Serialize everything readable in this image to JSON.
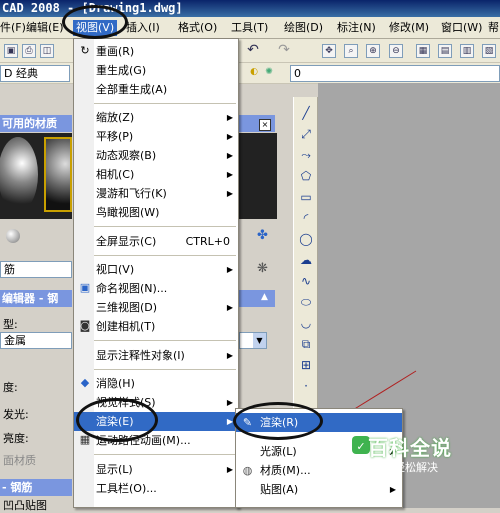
{
  "title": "CAD 2008 - [Drawing1.dwg]",
  "menubar": {
    "items": [
      "件(F)",
      "编辑(E)",
      "视图(V)",
      "插入(I)",
      "格式(O)",
      "工具(T)",
      "绘图(D)",
      "标注(N)",
      "修改(M)",
      "窗口(W)",
      "帮"
    ]
  },
  "toolbar": {
    "workspace_label": "D 经典",
    "layer_value": "0"
  },
  "palette": {
    "title1": "可用的材质",
    "combo_value": "筋",
    "title2": "编辑器 - 钢",
    "type_label": "型:",
    "template_value": "金属",
    "labels": [
      "度:",
      "发光:",
      "亮度:",
      "面材质"
    ],
    "title3": "- 钢筋",
    "bottom_label": "凹凸贴图"
  },
  "view_menu": {
    "items": [
      {
        "label": "重画(R)"
      },
      {
        "label": "重生成(G)"
      },
      {
        "label": "全部重生成(A)"
      },
      {
        "label": "缩放(Z)",
        "submenu": true
      },
      {
        "label": "平移(P)",
        "submenu": true
      },
      {
        "label": "动态观察(B)",
        "submenu": true
      },
      {
        "label": "相机(C)",
        "submenu": true
      },
      {
        "label": "漫游和飞行(K)",
        "submenu": true
      },
      {
        "label": "鸟瞰视图(W)"
      },
      {
        "label": "全屏显示(C)",
        "shortcut": "CTRL+0"
      },
      {
        "label": "视口(V)",
        "submenu": true
      },
      {
        "label": "命名视图(N)..."
      },
      {
        "label": "三维视图(D)",
        "submenu": true
      },
      {
        "label": "创建相机(T)"
      },
      {
        "label": "显示注释性对象(I)",
        "submenu": true
      },
      {
        "label": "消隐(H)"
      },
      {
        "label": "视觉样式(S)",
        "submenu": true
      },
      {
        "label": "渲染(E)",
        "submenu": true
      },
      {
        "label": "运动路径动画(M)..."
      },
      {
        "label": "显示(L)",
        "submenu": true
      },
      {
        "label": "工具栏(O)..."
      }
    ]
  },
  "render_submenu": {
    "items": [
      {
        "label": "渲染(R)"
      },
      {
        "label": "光源(L)",
        "submenu": true
      },
      {
        "label": "材质(M)..."
      },
      {
        "label": "贴图(A)",
        "submenu": true
      }
    ]
  },
  "watermark": {
    "text": "百科全说",
    "subtext": "助你轻松解决"
  },
  "colors": {
    "highlight": "#316ac5",
    "title_bar": "#0a246a",
    "canvas": "#a6a6a6"
  }
}
